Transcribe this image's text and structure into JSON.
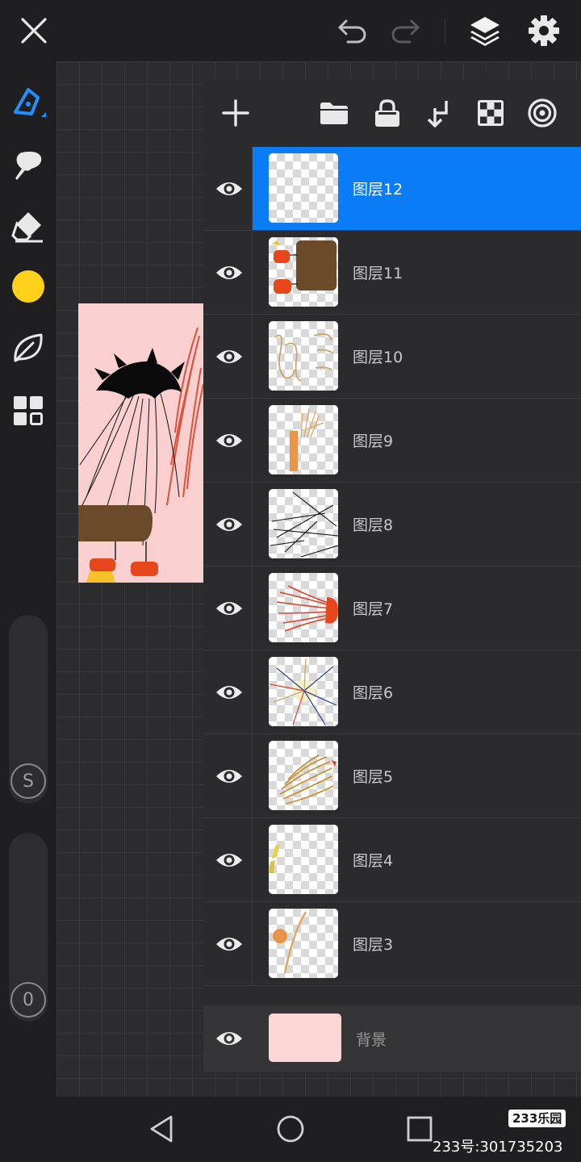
{
  "layers": [
    {
      "name": "图层12",
      "selected": true,
      "thumb": "empty"
    },
    {
      "name": "图层11",
      "selected": false,
      "thumb": "lanterns-wood"
    },
    {
      "name": "图层10",
      "selected": false,
      "thumb": "tan-scribble"
    },
    {
      "name": "图层9",
      "selected": false,
      "thumb": "orange-post"
    },
    {
      "name": "图层8",
      "selected": false,
      "thumb": "black-lines"
    },
    {
      "name": "图层7",
      "selected": false,
      "thumb": "red-strokes"
    },
    {
      "name": "图层6",
      "selected": false,
      "thumb": "burst"
    },
    {
      "name": "图层5",
      "selected": false,
      "thumb": "gold-strokes"
    },
    {
      "name": "图层4",
      "selected": false,
      "thumb": "yellow-bits"
    },
    {
      "name": "图层3",
      "selected": false,
      "thumb": "orange-stroke"
    }
  ],
  "background_layer": {
    "name": "背景",
    "color": "#fdd6d6"
  },
  "sliders": {
    "size_knob": "S",
    "opacity_knob": "0"
  },
  "colors": {
    "accent": "#0a7cf5",
    "current_color": "#ffd11a",
    "canvas_bg": "#f9cfcf"
  },
  "top_icons": [
    "close-icon",
    "undo-icon",
    "redo-icon",
    "layers-icon",
    "gear-icon"
  ],
  "watermark": {
    "logo": "233乐园",
    "id": "233号:301735203"
  }
}
